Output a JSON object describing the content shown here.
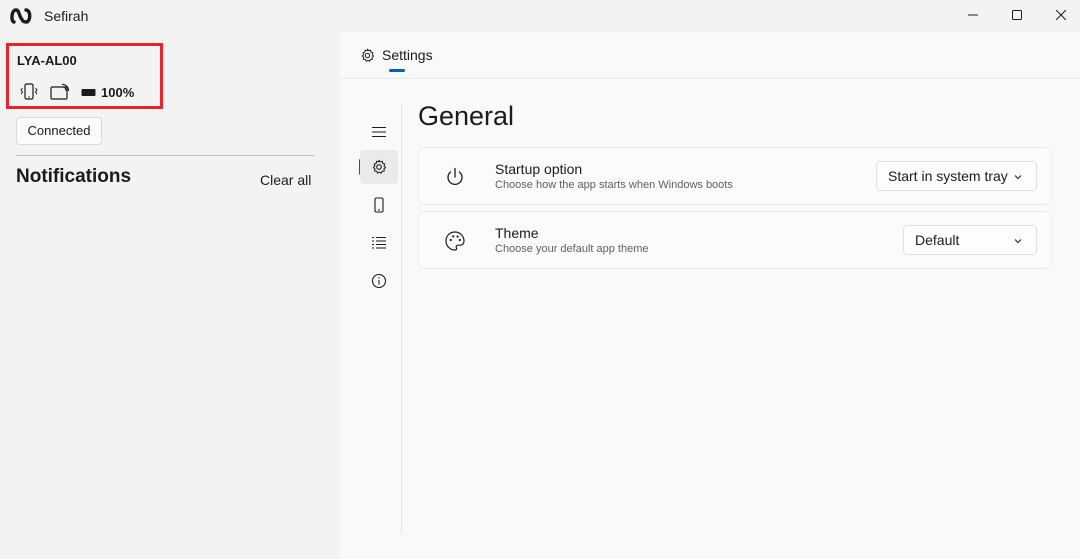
{
  "window": {
    "title": "Sefirah",
    "logo_icon": "sefirah-logo-icon",
    "controls": [
      "minimize-icon",
      "maximize-icon",
      "close-icon"
    ]
  },
  "device": {
    "name": "LYA-AL00",
    "icons": [
      "phone-vibrate-icon",
      "cast-screen-icon",
      "battery-icon"
    ],
    "battery": "100%",
    "status_button": "Connected",
    "highlight_color": "#e8232a"
  },
  "notifications": {
    "title": "Notifications",
    "clear_label": "Clear all"
  },
  "header": {
    "tab_label": "Settings",
    "tab_icon": "gear-icon",
    "accent": "#005fb8"
  },
  "nav": {
    "items": [
      "menu-icon",
      "gear-icon",
      "phone-icon",
      "list-icon",
      "info-icon"
    ],
    "selected": "gear-icon"
  },
  "page": {
    "title": "General",
    "settings": [
      {
        "title": "Startup option",
        "description": "Choose how the app starts when Windows boots",
        "value": "Start in system tray",
        "icon": "power-icon"
      },
      {
        "title": "Theme",
        "description": "Choose your default app theme",
        "value": "Default",
        "icon": "palette-icon"
      }
    ]
  }
}
